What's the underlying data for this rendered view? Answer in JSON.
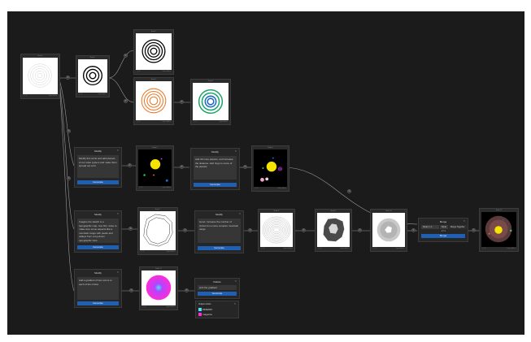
{
  "canvas": {
    "background": "#1b1b1b"
  },
  "nodes": {
    "source": {
      "header": "Source",
      "footer_left": "▢ ⟲",
      "footer_right": "Open Editor"
    },
    "rings_a": {
      "header": "Node 1",
      "footer_left": "▢ ⟲",
      "footer_right": "Open Editor"
    },
    "rings_b": {
      "header": "Node 2",
      "footer_left": "▢ ⟲",
      "footer_right": "Open Editor"
    },
    "rings_orange": {
      "header": "Node 3",
      "footer_left": "▢ ⟲",
      "footer_right": "Open Editor"
    },
    "rings_green": {
      "header": "Node 4",
      "footer_left": "▢ ⟲",
      "footer_right": "Open Editor"
    },
    "solar_1": {
      "header": "Node 5",
      "footer_left": "▢ ⟲",
      "footer_right": "Open Editor"
    },
    "solar_2": {
      "header": "Node 6",
      "footer_left": "▢ ⟲",
      "footer_right": "Open Editor"
    },
    "outline": {
      "header": "Node 7",
      "footer_left": "▢ ⟲",
      "footer_right": "Open Editor"
    },
    "contour": {
      "header": "Node 8",
      "footer_left": "▢ ⟲",
      "footer_right": "Open Editor"
    },
    "dark_blob": {
      "header": "Node 9",
      "footer_left": "▢ ⟲",
      "footer_right": "Open Editor"
    },
    "light_blob": {
      "header": "Node 10",
      "footer_left": "▢ ⟲",
      "footer_right": "Open Editor"
    },
    "gradient": {
      "header": "Node 11",
      "footer_left": "▢ ⟲",
      "footer_right": "Open Editor"
    },
    "result": {
      "header": "Node 12",
      "footer_left": "▢ ⟲",
      "footer_right": "Open Editor"
    }
  },
  "panels": {
    "modify_a": {
      "title": "Modify",
      "text": "Modify this circle and add planets of our solar system and make them spread out a bit",
      "button": "Generate"
    },
    "modify_b": {
      "title": "Modify",
      "text": "Add 40 more planets, and increase the distance. Add rings to some of the planets",
      "button": "Generate"
    },
    "modify_c": {
      "title": "Modify",
      "text": "Imagine the sketch is a topographic map. Use fbm noise to make sure some aspects like a mountain range with peaks and valleys from a top-down topographic view",
      "button": "Generate"
    },
    "modify_d": {
      "title": "Modify",
      "text": "Good. Increase the number of circles for a more complex mountain range",
      "button": "Generate"
    },
    "modify_e": {
      "title": "Modify",
      "text": "Add a gradient of two colors to each of the circles",
      "button": "Generate"
    },
    "palette": {
      "title": "Palette",
      "field": "pick the gradient",
      "button": "Generate",
      "section": "Output colors",
      "colors": [
        {
          "label": "#46E6FF",
          "hex": "#46e6ff"
        },
        {
          "label": "magenta",
          "hex": "#ff2bd8"
        }
      ]
    },
    "merge": {
      "title": "Merge",
      "input_a": "Node 1 / ▾",
      "input_b": "Node 2 / ▾",
      "label": "Merge Together",
      "button": "Merge"
    }
  },
  "pins": {
    "glyph": "⊕"
  },
  "colors": {
    "orange": "#e87a2a",
    "green": "#1fa36a",
    "blue": "#1e66c8",
    "yellow": "#f5e400",
    "magenta": "#ff2bd8",
    "cyan": "#46e6ff"
  }
}
